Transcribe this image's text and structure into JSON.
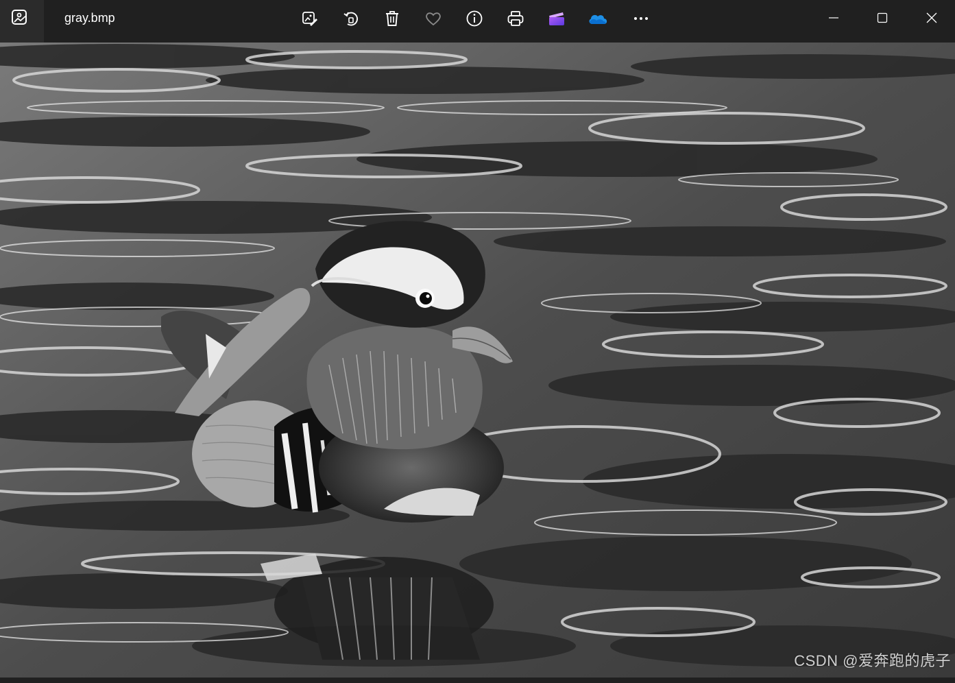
{
  "window": {
    "title": "gray.bmp"
  },
  "toolbar": {
    "tools": [
      {
        "name": "edit-image-icon"
      },
      {
        "name": "rotate-icon"
      },
      {
        "name": "delete-icon"
      },
      {
        "name": "favorite-heart-icon"
      },
      {
        "name": "info-icon"
      },
      {
        "name": "print-icon"
      },
      {
        "name": "clipchamp-icon"
      },
      {
        "name": "onedrive-cloud-icon"
      },
      {
        "name": "more-options-icon"
      }
    ]
  },
  "window_controls": [
    "minimize-icon",
    "maximize-icon",
    "close-icon"
  ],
  "image": {
    "subject": "grayscale mandarin duck on rippled water",
    "watermark": "CSDN @爱奔跑的虎子"
  },
  "colors": {
    "titlebar_bg": "#202020",
    "tab_bg": "#2b2b2b",
    "text": "#ffffff",
    "onedrive_blue": "#1e8fe6",
    "clipchamp_purple": "#8a4cf0"
  }
}
